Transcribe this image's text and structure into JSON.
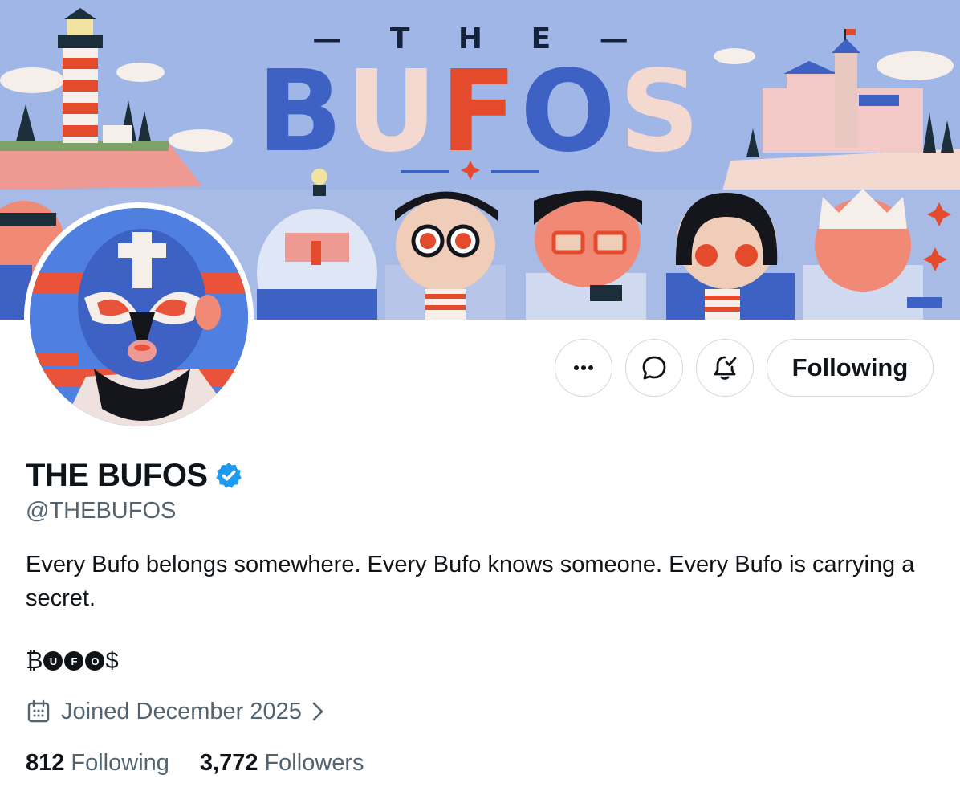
{
  "banner": {
    "the_text": "— T H E —",
    "title_letters": [
      "B",
      "U",
      "F",
      "O",
      "S"
    ]
  },
  "profile": {
    "display_name": "THE BUFOS",
    "handle": "@THEBUFOS",
    "bio": "Every Bufo belongs somewhere. Every Bufo knows someone. Every Bufo is carrying a secret.",
    "token": {
      "prefix": "₿",
      "letters": [
        "U",
        "F",
        "O"
      ],
      "suffix": "$"
    },
    "joined": "Joined December 2025",
    "following_count": "812",
    "following_label": "Following",
    "followers_count": "3,772",
    "followers_label": "Followers"
  },
  "actions": {
    "more_label": "···",
    "following_button": "Following"
  },
  "icons": {
    "more": "more-horizontal-icon",
    "message": "message-bubble-icon",
    "notify": "bell-check-icon",
    "verified": "verified-badge-icon",
    "calendar": "calendar-icon",
    "chevron": "chevron-right-icon"
  },
  "colors": {
    "verified_blue": "#1d9bf0",
    "text_primary": "#0f1419",
    "text_secondary": "#536471",
    "border": "#cfd9de",
    "banner_sky": "#9fb6e6",
    "banner_blue": "#3d62c4",
    "banner_red": "#e44a2c"
  }
}
